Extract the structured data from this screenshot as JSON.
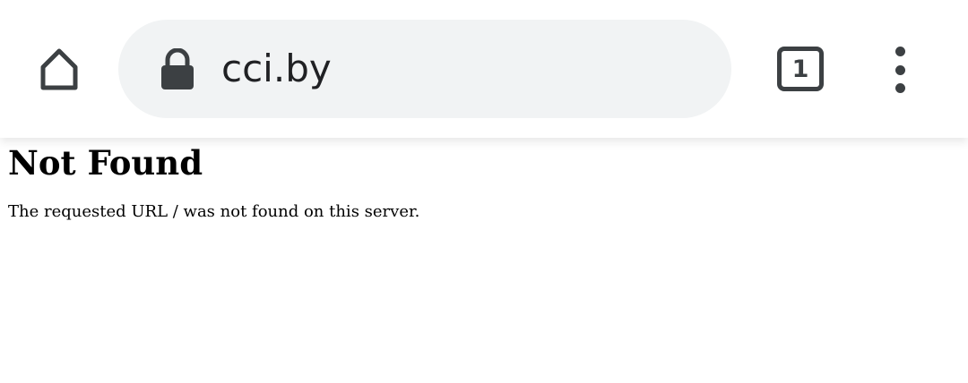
{
  "browser": {
    "address_bar": {
      "url": "cci.by",
      "secure_icon": "lock-icon"
    },
    "tab_count": "1",
    "icons": {
      "home": "home-icon",
      "menu": "more-vertical-icon"
    },
    "colors": {
      "omnibox_bg": "#f1f3f4",
      "icon": "#3c4043"
    }
  },
  "page": {
    "heading": "Not Found",
    "message": "The requested URL / was not found on this server."
  }
}
